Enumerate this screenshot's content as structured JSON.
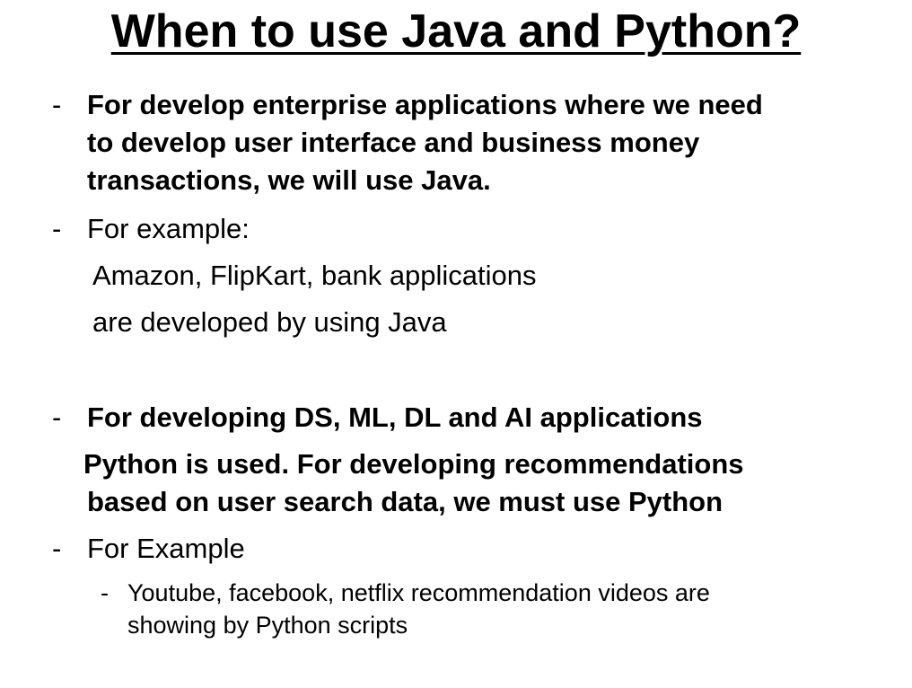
{
  "slide": {
    "title": "When to use Java and Python?",
    "bullet_marker": "-",
    "bullets": [
      {
        "lines": [
          "For develop enterprise applications where we need",
          "to develop user interface and business money",
          "transactions, we will use Java."
        ]
      },
      {
        "lines": [
          "For example:",
          "Amazon, FlipKart, bank applications",
          "are developed by using Java"
        ]
      },
      {
        "lines": [
          "For developing DS, ML, DL and AI applications",
          "Python is used. For developing recommendations",
          "based on user search data, we must use Python"
        ]
      },
      {
        "lines": [
          "For Example"
        ]
      }
    ],
    "sub_bullets": [
      {
        "lines": [
          "Youtube, facebook, netflix recommendation videos are",
          "showing by Python scripts"
        ]
      }
    ]
  }
}
